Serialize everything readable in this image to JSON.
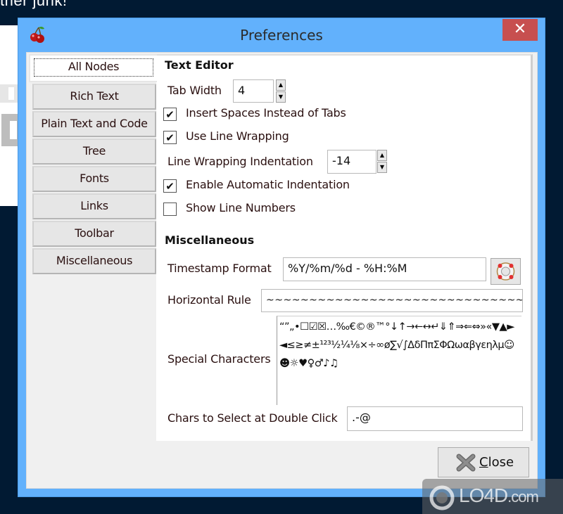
{
  "background": {
    "title_fragment": "ther junk!"
  },
  "dialog": {
    "title": "Preferences",
    "icon": "cherry-icon",
    "close_glyph": "✕"
  },
  "tabs": [
    {
      "label": "All Nodes",
      "active": true
    },
    {
      "label": "Rich Text",
      "active": false
    },
    {
      "label": "Plain Text and Code",
      "active": false
    },
    {
      "label": "Tree",
      "active": false
    },
    {
      "label": "Fonts",
      "active": false
    },
    {
      "label": "Links",
      "active": false
    },
    {
      "label": "Toolbar",
      "active": false
    },
    {
      "label": "Miscellaneous",
      "active": false
    }
  ],
  "text_editor": {
    "heading": "Text Editor",
    "tab_width": {
      "label": "Tab Width",
      "value": "4"
    },
    "insert_spaces": {
      "label": "Insert Spaces Instead of Tabs",
      "checked": true,
      "mark": "✔"
    },
    "line_wrapping": {
      "label": "Use Line Wrapping",
      "checked": true,
      "mark": "✔"
    },
    "wrap_indent": {
      "label": "Line Wrapping Indentation",
      "value": "-14"
    },
    "auto_indent": {
      "label": "Enable Automatic Indentation",
      "checked": true,
      "mark": "✔"
    },
    "line_numbers": {
      "label": "Show Line Numbers",
      "checked": false,
      "mark": ""
    }
  },
  "spinner": {
    "up": "▲",
    "down": "▼"
  },
  "miscellaneous": {
    "heading": "Miscellaneous",
    "timestamp_format": {
      "label": "Timestamp Format",
      "value": "%Y/%m/%d - %H:%M"
    },
    "horizontal_rule": {
      "label": "Horizontal Rule",
      "value": "~~~~~~~~~~~~~~~~~~~~~~~~~~~~~~~~~~"
    },
    "special_characters": {
      "label": "Special Characters",
      "value": "“”„•☐☑☒…‰€©®™°↓↑→←↔↵⇓⇑⇒⇐⇔»«▼▲►◄≤≥≠±¹²³½¼⅛×÷∞ø∑√∫ΔδΠπΣΦΩωαβγεηλμ☺☻☼♥♀♂♪♫"
    },
    "double_click_chars": {
      "label": "Chars to Select at Double Click",
      "value": ".-@"
    }
  },
  "footer": {
    "close_label_prefix": "",
    "close_label_mnemonic": "C",
    "close_label_rest": "lose"
  },
  "watermark": {
    "brand": "LO4D",
    "suffix": ".com"
  }
}
